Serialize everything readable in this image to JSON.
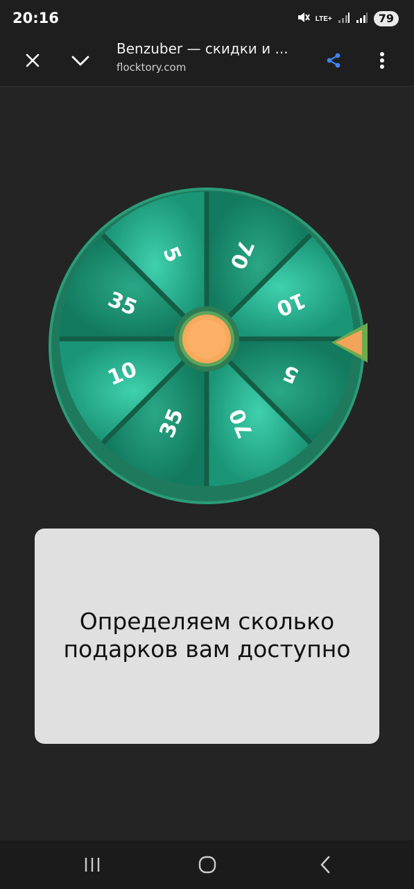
{
  "status_bar": {
    "time": "20:16",
    "network": "LTE+",
    "battery": "79",
    "icons": [
      "mute-icon",
      "signal-icon",
      "signal-icon",
      "battery-icon"
    ]
  },
  "browser": {
    "title": "Benzuber — скидки и ...",
    "url": "flocktory.com",
    "icons": [
      "close-icon",
      "chevron-down-icon",
      "share-icon",
      "more-vert-icon"
    ],
    "accent": "#4285f4"
  },
  "wheel": {
    "segments": [
      "5",
      "70",
      "10",
      "5",
      "70",
      "35",
      "10",
      "35"
    ],
    "colors": {
      "outer_ring": "#1e7f5f",
      "segment_light": "#22a88a",
      "segment_dark": "#17876a",
      "hub": "#f7a95c",
      "pointer": "#f4a35a"
    }
  },
  "message": {
    "text": "Определяем сколько подарков вам доступно"
  },
  "nav_bar": {
    "icons": [
      "recent-apps-icon",
      "home-icon",
      "back-icon"
    ]
  }
}
